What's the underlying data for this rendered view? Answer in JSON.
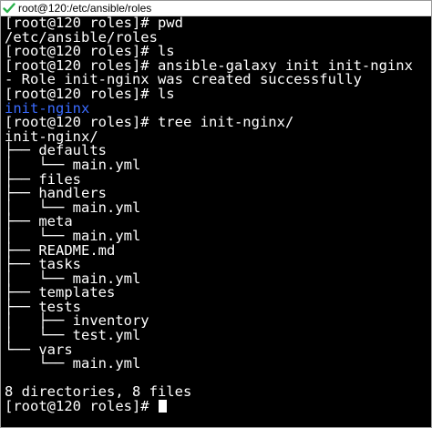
{
  "window": {
    "title": "root@120:/etc/ansible/roles",
    "icon": "terminal-check-icon",
    "colors": {
      "background": "#000000",
      "text": "#ffffff",
      "directory": "#3a6bff",
      "icon": "#2bb24c"
    }
  },
  "terminal": {
    "lines": [
      "[root@120 roles]# pwd",
      "/etc/ansible/roles",
      "[root@120 roles]# ls",
      "[root@120 roles]# ansible-galaxy init init-nginx",
      "- Role init-nginx was created successfully",
      "[root@120 roles]# ls",
      "init-nginx",
      "[root@120 roles]# tree init-nginx/",
      "init-nginx/",
      "├── defaults",
      "│   └── main.yml",
      "├── files",
      "├── handlers",
      "│   └── main.yml",
      "├── meta",
      "│   └── main.yml",
      "├── README.md",
      "├── tasks",
      "│   └── main.yml",
      "├── templates",
      "├── tests",
      "│   ├── inventory",
      "│   └── test.yml",
      "└── vars",
      "    └── main.yml",
      "",
      "8 directories, 8 files",
      "[root@120 roles]# "
    ],
    "directory_line_index": 6,
    "cursor_visible": true
  }
}
